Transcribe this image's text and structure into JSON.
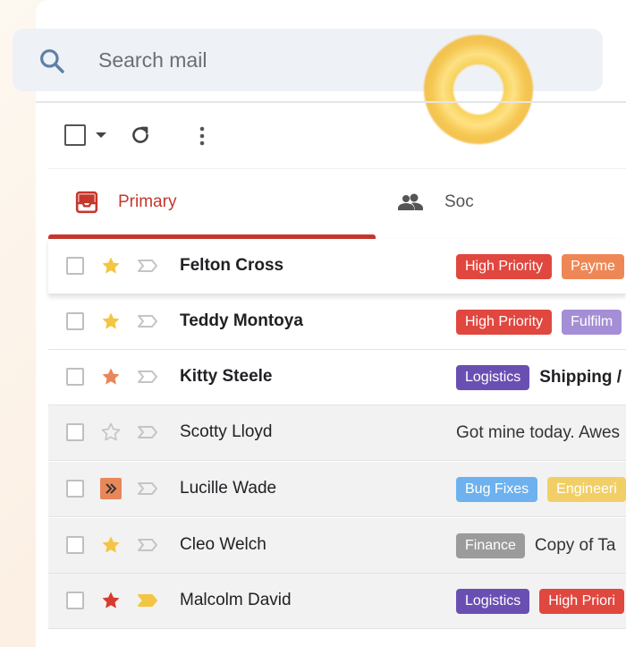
{
  "search": {
    "placeholder": "Search mail"
  },
  "tabs": [
    {
      "label": "Primary",
      "active": true
    },
    {
      "label": "Soc",
      "active": false
    }
  ],
  "colors": {
    "accent": "#c5372c",
    "star_yellow": "#f4c542",
    "star_orange": "#e8875a",
    "star_red": "#d93a2e",
    "chip_high_priority": "#e0473f",
    "chip_payment": "#ee8756",
    "chip_fulfillment": "#a48fd6",
    "chip_logistics": "#6a4fb3",
    "chip_bug_fixes": "#6db2ee",
    "chip_engineering": "#f2cf66",
    "chip_finance": "#9b9b9b"
  },
  "emails": [
    {
      "sender": "Felton Cross",
      "bold": true,
      "star": "yellow",
      "important": false,
      "chips": [
        {
          "label": "High Priority",
          "color": "#e0473f"
        },
        {
          "label": "Payme",
          "color": "#ee8756"
        }
      ],
      "text": ""
    },
    {
      "sender": "Teddy Montoya",
      "bold": true,
      "star": "yellow",
      "important": false,
      "chips": [
        {
          "label": "High Priority",
          "color": "#e0473f"
        },
        {
          "label": "Fulfilm",
          "color": "#a48fd6"
        }
      ],
      "text": ""
    },
    {
      "sender": "Kitty Steele",
      "bold": true,
      "star": "orange",
      "important": false,
      "chips": [
        {
          "label": "Logistics",
          "color": "#6a4fb3"
        }
      ],
      "text": "Shipping /"
    },
    {
      "sender": "Scotty Lloyd",
      "bold": false,
      "star": "none",
      "important": false,
      "chips": [],
      "text": "Got mine today. Awes"
    },
    {
      "sender": "Lucille Wade",
      "bold": false,
      "star": "double",
      "important": false,
      "chips": [
        {
          "label": "Bug Fixes",
          "color": "#6db2ee"
        },
        {
          "label": "Engineeri",
          "color": "#f2cf66"
        }
      ],
      "text": ""
    },
    {
      "sender": "Cleo Welch",
      "bold": false,
      "star": "yellow",
      "important": false,
      "chips": [
        {
          "label": "Finance",
          "color": "#9b9b9b"
        }
      ],
      "text": "Copy of Ta"
    },
    {
      "sender": "Malcolm David",
      "bold": false,
      "star": "red",
      "important": true,
      "chips": [
        {
          "label": "Logistics",
          "color": "#6a4fb3"
        },
        {
          "label": "High Priori",
          "color": "#e0473f"
        }
      ],
      "text": ""
    }
  ]
}
